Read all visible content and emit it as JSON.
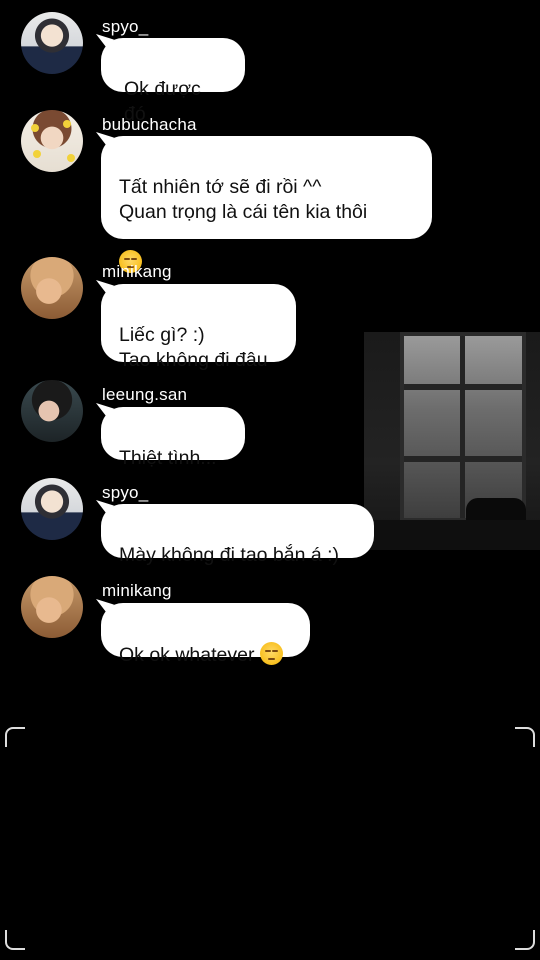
{
  "messages": [
    {
      "username": "spyo_",
      "text": "Ok được đó",
      "emoji": null
    },
    {
      "username": "bubuchacha",
      "text": "Tất nhiên tớ sẽ đi rồi ^^\nQuan trọng là cái tên kia thôi",
      "emoji": "unamused-face"
    },
    {
      "username": "minikang",
      "text": "Liếc gì? :)\nTao không đi đâu",
      "emoji": null
    },
    {
      "username": "leeung.san",
      "text": "Thiệt tình...",
      "emoji": null
    },
    {
      "username": "spyo_",
      "text": "Mày không đi tao bắn á :)",
      "emoji": null
    },
    {
      "username": "minikang",
      "text": "Ok ok whatever ",
      "emoji": "unamused-face"
    }
  ],
  "colors": {
    "background": "#000000",
    "bubble": "#ffffff",
    "bubble_text": "#111111"
  }
}
